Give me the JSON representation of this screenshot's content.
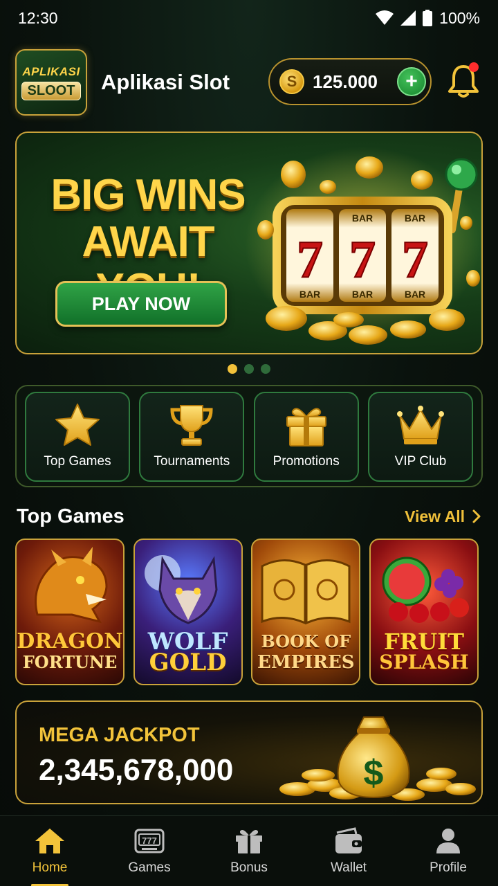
{
  "status_bar": {
    "time": "12:30",
    "battery": "100%"
  },
  "header": {
    "logo_line1": "APLIKASI",
    "logo_line2": "SLOOT",
    "app_name": "Aplikasi Slot",
    "balance": "125.000",
    "coin_symbol": "S",
    "add_symbol": "+"
  },
  "banner": {
    "headline_line1": "BIG WINS",
    "headline_line2": "AWAIT YOU!",
    "cta_label": "PLAY NOW",
    "reel_top": [
      "BAR",
      "BAR"
    ],
    "reel_main": [
      "7",
      "7",
      "7"
    ],
    "reel_bottom": [
      "BAR",
      "BAR",
      "BAR"
    ],
    "carousel_active_index": 0,
    "carousel_count": 3
  },
  "quick_links": [
    {
      "label": "Top Games",
      "icon": "star-icon"
    },
    {
      "label": "Tournaments",
      "icon": "trophy-icon"
    },
    {
      "label": "Promotions",
      "icon": "gift-icon"
    },
    {
      "label": "VIP Club",
      "icon": "crown-icon"
    }
  ],
  "top_games": {
    "title": "Top Games",
    "view_all": "View All",
    "games": [
      {
        "line1": "DRAGON",
        "line2": "FORTUNE"
      },
      {
        "line1": "WOLF",
        "line2": "GOLD"
      },
      {
        "line1": "BOOK OF",
        "line2": "EMPIRES"
      },
      {
        "line1": "FRUIT",
        "line2": "SPLASH"
      }
    ]
  },
  "jackpot": {
    "label": "MEGA JACKPOT",
    "value": "2,345,678,000",
    "bag_symbol": "$"
  },
  "bottom_nav": [
    {
      "label": "Home",
      "icon": "home-icon",
      "active": true
    },
    {
      "label": "Games",
      "icon": "slot-machine-icon",
      "active": false
    },
    {
      "label": "Bonus",
      "icon": "gift-icon",
      "active": false
    },
    {
      "label": "Wallet",
      "icon": "wallet-icon",
      "active": false
    },
    {
      "label": "Profile",
      "icon": "profile-icon",
      "active": false
    }
  ],
  "colors": {
    "gold": "#f2c33a",
    "green": "#1f8a36",
    "background": "#0a120d",
    "notification": "#ff2d2d"
  }
}
